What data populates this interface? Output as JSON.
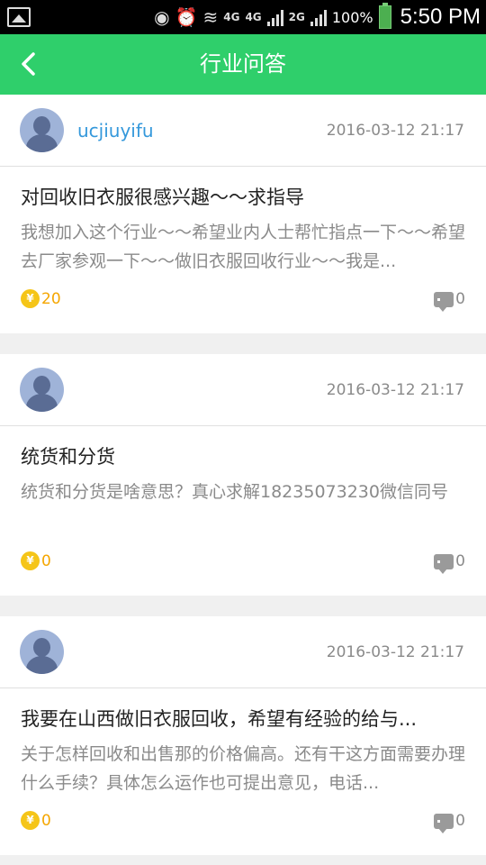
{
  "status": {
    "net1": "4G",
    "net2": "4G",
    "net3": "2G",
    "battery": "100%",
    "time": "5:50 PM"
  },
  "header": {
    "title": "行业问答"
  },
  "posts": [
    {
      "username": "ucjiuyifu",
      "date": "2016-03-12 21:17",
      "title": "对回收旧衣服很感兴趣～～求指导",
      "body": " 我想加入这个行业～～希望业内人士帮忙指点一下～～希望去厂家参观一下～～做旧衣服回收行业～～我是...",
      "reward": "20",
      "comments": "0"
    },
    {
      "username": "",
      "date": "2016-03-12 21:17",
      "title": "统货和分货",
      "body": " 统货和分货是啥意思？真心求解18235073230微信同号",
      "reward": "0",
      "comments": "0"
    },
    {
      "username": "",
      "date": "2016-03-12 21:17",
      "title": "我要在山西做旧衣服回收，希望有经验的给与...",
      "body": " 关于怎样回收和出售那的价格偏高。还有干这方面需要办理什么手续？具体怎么运作也可提出意见，电话...",
      "reward": "0",
      "comments": "0"
    }
  ],
  "colors": {
    "accent": "#2fcf6b",
    "link": "#3498db",
    "coin": "#f5c518"
  },
  "icons": {
    "back": "chevron-left-icon",
    "coin": "yen-coin-icon",
    "comment": "comment-icon"
  }
}
